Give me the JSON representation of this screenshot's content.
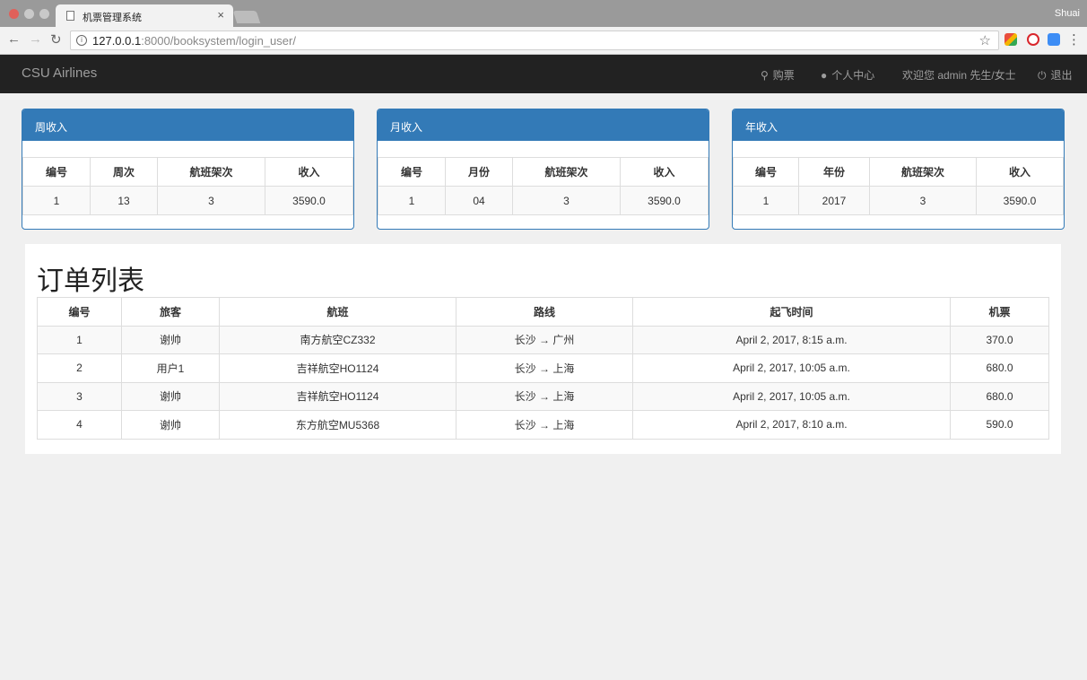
{
  "browser": {
    "tab_title": "机票管理系统",
    "tab_close": "×",
    "profile": "Shuai",
    "url_host": "127.0.0.1",
    "url_rest": ":8000/booksystem/login_user/"
  },
  "navbar": {
    "brand": "CSU Airlines",
    "buy_ticket": "购票",
    "personal_center": "个人中心",
    "welcome": "欢迎您 admin 先生/女士",
    "logout": "退出"
  },
  "panels": {
    "weekly": {
      "title": "周收入",
      "headers": [
        "编号",
        "周次",
        "航班架次",
        "收入"
      ],
      "row": [
        "1",
        "13",
        "3",
        "3590.0"
      ]
    },
    "monthly": {
      "title": "月收入",
      "headers": [
        "编号",
        "月份",
        "航班架次",
        "收入"
      ],
      "row": [
        "1",
        "04",
        "3",
        "3590.0"
      ]
    },
    "yearly": {
      "title": "年收入",
      "headers": [
        "编号",
        "年份",
        "航班架次",
        "收入"
      ],
      "row": [
        "1",
        "2017",
        "3",
        "3590.0"
      ]
    }
  },
  "orders": {
    "title": "订单列表",
    "headers": [
      "编号",
      "旅客",
      "航班",
      "路线",
      "起飞时间",
      "机票"
    ],
    "rows": [
      [
        "1",
        "谢帅",
        "南方航空CZ332",
        "长沙 → 广州",
        "April 2, 2017, 8:15 a.m.",
        "370.0"
      ],
      [
        "2",
        "用户1",
        "吉祥航空HO1124",
        "长沙 → 上海",
        "April 2, 2017, 10:05 a.m.",
        "680.0"
      ],
      [
        "3",
        "谢帅",
        "吉祥航空HO1124",
        "长沙 → 上海",
        "April 2, 2017, 10:05 a.m.",
        "680.0"
      ],
      [
        "4",
        "谢帅",
        "东方航空MU5368",
        "长沙 → 上海",
        "April 2, 2017, 8:10 a.m.",
        "590.0"
      ]
    ]
  },
  "colors": {
    "panel_primary": "#337ab7",
    "navbar_bg": "#222222"
  }
}
